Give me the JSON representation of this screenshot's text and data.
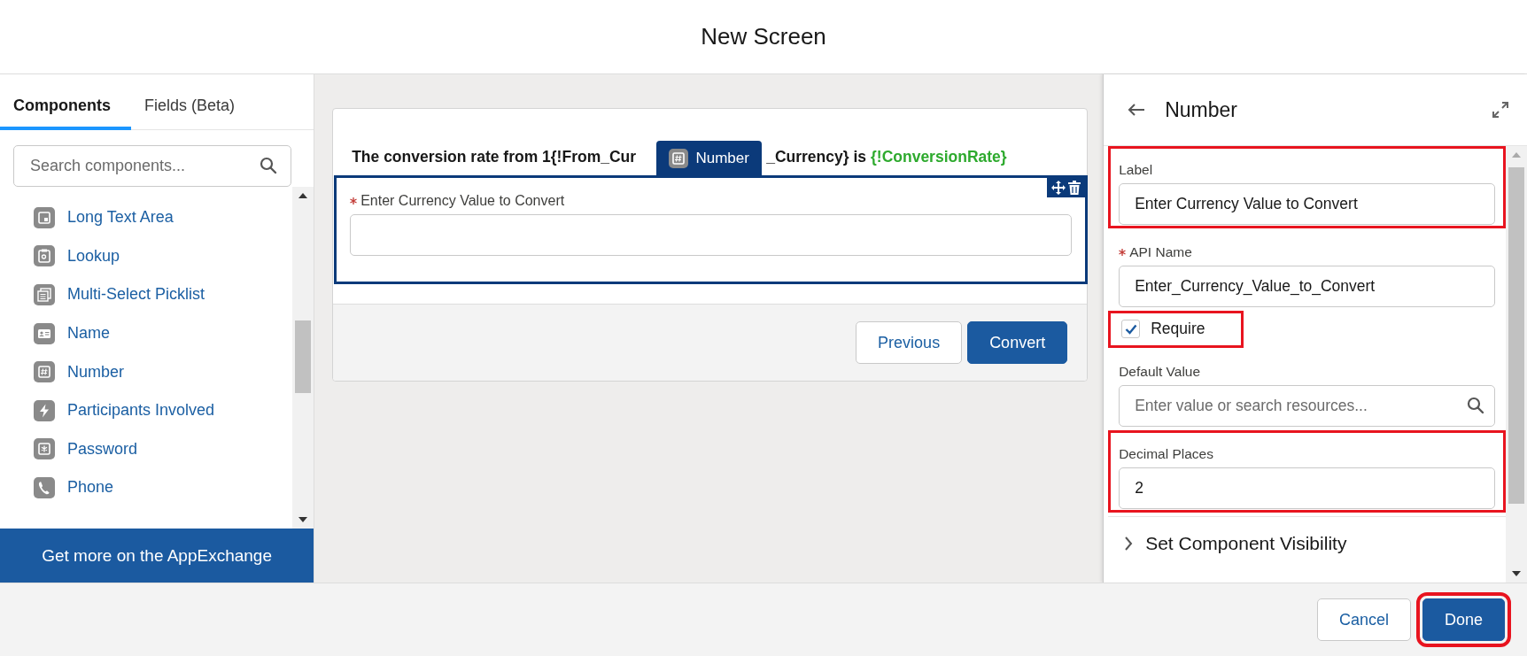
{
  "window": {
    "title": "New Screen"
  },
  "left_panel": {
    "tabs": [
      {
        "label": "Components",
        "selected": true
      },
      {
        "label": "Fields (Beta)",
        "selected": false
      }
    ],
    "search": {
      "placeholder": "Search components..."
    },
    "items": [
      {
        "label": "Long Text Area",
        "kind": "textarea"
      },
      {
        "label": "Lookup",
        "kind": "lookup"
      },
      {
        "label": "Multi-Select Picklist",
        "kind": "multiselect"
      },
      {
        "label": "Name",
        "kind": "name"
      },
      {
        "label": "Number",
        "kind": "number"
      },
      {
        "label": "Participants Involved",
        "kind": "lightning"
      },
      {
        "label": "Password",
        "kind": "password"
      },
      {
        "label": "Phone",
        "kind": "phone"
      }
    ],
    "appexchange_button": "Get more on the AppExchange"
  },
  "canvas": {
    "heading": [
      "The conversion rate from 1{!From_Cur",
      "_Currency} is"
    ],
    "heading_variable": "{!ConversionRate}",
    "component_badge": "Number",
    "field": {
      "label": "Enter Currency Value to Convert",
      "required": true
    },
    "buttons": [
      {
        "label": "Previous",
        "kind": "neutral"
      },
      {
        "label": "Convert",
        "kind": "brand"
      }
    ]
  },
  "properties": {
    "title": "Number",
    "fields": [
      {
        "kind": "text",
        "label": "Label",
        "value": "Enter Currency Value to Convert",
        "required": false,
        "highlighted": true
      },
      {
        "kind": "text",
        "label": "API Name",
        "value": "Enter_Currency_Value_to_Convert",
        "required": true,
        "highlighted": false
      },
      {
        "kind": "checkbox",
        "label": "Require",
        "checked": true,
        "highlighted": true
      },
      {
        "kind": "search",
        "label": "Default Value",
        "placeholder": "Enter value or search resources...",
        "required": false,
        "highlighted": false
      },
      {
        "kind": "text",
        "label": "Decimal Places",
        "value": "2",
        "required": false,
        "highlighted": true
      }
    ],
    "section": {
      "label": "Set Component Visibility",
      "expanded": false
    }
  },
  "footer": {
    "buttons": [
      {
        "label": "Cancel",
        "kind": "neutral",
        "highlighted": false
      },
      {
        "label": "Done",
        "kind": "brand",
        "highlighted": true
      }
    ]
  }
}
